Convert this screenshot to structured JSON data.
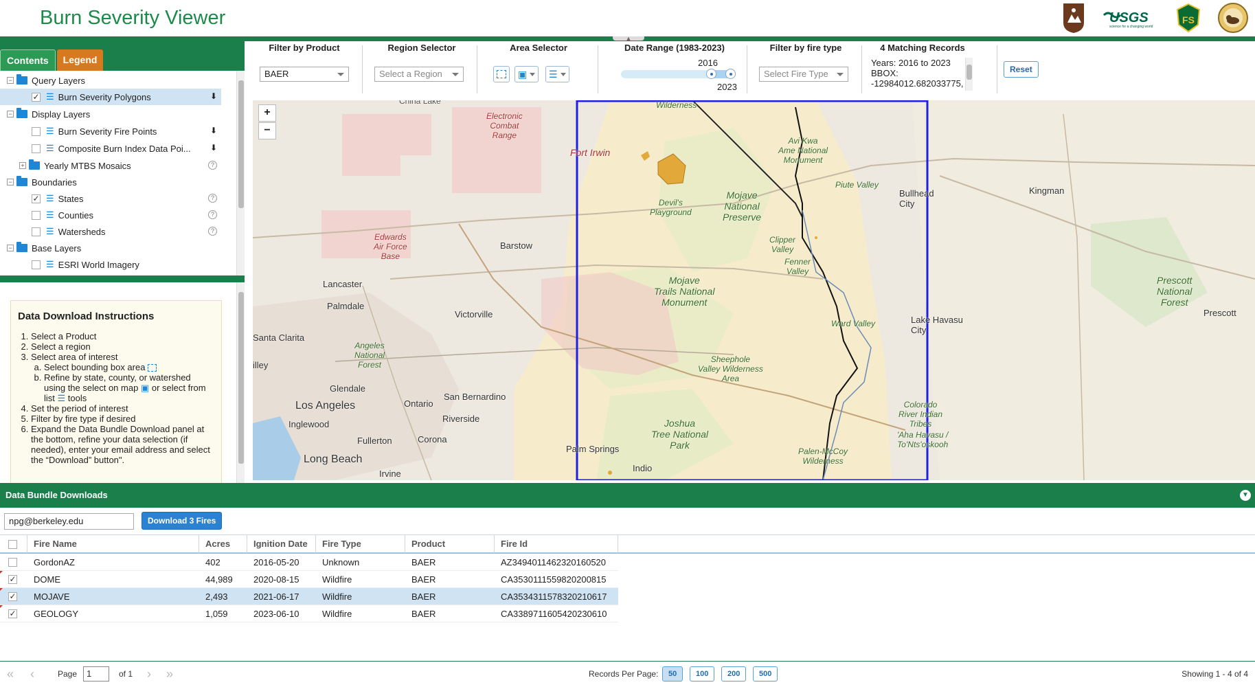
{
  "app": {
    "title": "Burn Severity Viewer"
  },
  "left_panel": {
    "tabs": [
      {
        "label": "Contents"
      },
      {
        "label": "Legend"
      }
    ],
    "toc": {
      "query_layers": "Query Layers",
      "burn_severity_polygons": "Burn Severity Polygons",
      "display_layers": "Display Layers",
      "burn_severity_fire_points": "Burn Severity Fire Points",
      "composite_burn_index": "Composite Burn Index Data Poi...",
      "yearly_mtbs_mosaics": "Yearly MTBS Mosaics",
      "boundaries": "Boundaries",
      "states": "States",
      "counties": "Counties",
      "watersheds": "Watersheds",
      "base_layers": "Base Layers",
      "esri_world_imagery": "ESRI World Imagery"
    },
    "instructions": {
      "title": "Data Download Instructions",
      "step1": "Select a Product",
      "step2": "Select a region",
      "step3": "Select area of interest",
      "step3a": "Select bounding box area",
      "step3b_1": "Refine by state, county, or watershed using the select on map",
      "step3b_2": "or select from list",
      "step3b_3": "tools",
      "step4": "Set the period of interest",
      "step5": "Filter by fire type if desired",
      "step6": "Expand the Data Bundle Download panel at the bottom, refine your data selection (if needed), enter your email address and select the “Download” button\"."
    }
  },
  "filters": {
    "product": {
      "title": "Filter by Product",
      "value": "BAER"
    },
    "region": {
      "title": "Region Selector",
      "placeholder": "Select a Region"
    },
    "area": {
      "title": "Area Selector"
    },
    "date_range": {
      "title": "Date Range (1983-2023)",
      "start": "2016",
      "end": "2023",
      "range_start_fraction": 0.825,
      "range_end_fraction": 1.0
    },
    "fire_type": {
      "title": "Filter by fire type",
      "placeholder": "Select Fire Type"
    },
    "records": {
      "title": "4 Matching Records",
      "line1": "Years: 2016 to 2023",
      "line2": "BBOX:",
      "line3": "-12984012.682033775,"
    },
    "reset_label": "Reset"
  },
  "map": {
    "zoom_in": "+",
    "zoom_out": "−",
    "labels": {
      "china_lake": "China Lake",
      "electronic_combat": "Electronic\nCombat\nRange",
      "fort_irwin": "Fort Irwin",
      "wilderness_top": "Wilderness",
      "avi_kwa_ame": "Avi Kwa\nAme National\nMonument",
      "piute_valley": "Piute Valley",
      "bullhead_city": "Bullhead\nCity",
      "kingman": "Kingman",
      "devils_playground": "Devil's\nPlayground",
      "mojave_preserve": "Mojave\nNational\nPreserve",
      "clipper_valley": "Clipper\nValley",
      "fenner_valley": "Fenner\nValley",
      "barstow": "Barstow",
      "edwards": "Edwards\nAir Force\nBase",
      "lancaster": "Lancaster",
      "palmdale": "Palmdale",
      "mojave_trails": "Mojave\nTrails National\nMonument",
      "victorville": "Victorville",
      "lake_havasu": "Lake Havasu\nCity",
      "prescott_forest": "Prescott\nNational\nForest",
      "prescott": "Prescott",
      "santa_clarita": "Santa Clarita",
      "angeles": "Angeles\nNational\nForest",
      "ward_valley": "Ward Valley",
      "sheephole": "Sheephole\nValley Wilderness\nArea",
      "glendale": "Glendale",
      "san_bernardino": "San Bernardino",
      "los_angeles": "Los Angeles",
      "ontario": "Ontario",
      "inglewood": "Inglewood",
      "riverside": "Riverside",
      "fullerton": "Fullerton",
      "corona": "Corona",
      "long_beach": "Long Beach",
      "irvine": "Irvine",
      "joshua_tree": "Joshua\nTree National\nPark",
      "palm_springs": "Palm Springs",
      "indio": "Indio",
      "colorado_river": "Colorado\nRiver Indian\nTribes",
      "avi_havasu": "'Aha Havasu /\nTo'Nts'oskooh",
      "palen_mccoy": "Palen-McCoy\nWilderness",
      "illey": "illey"
    }
  },
  "bundle": {
    "title": "Data Bundle Downloads",
    "email_value": "npg@berkeley.edu",
    "download_label": "Download 3 Fires",
    "columns": [
      "Fire Name",
      "Acres",
      "Ignition Date",
      "Fire Type",
      "Product",
      "Fire Id"
    ],
    "rows": [
      {
        "checked": false,
        "selected": false,
        "name": "GordonAZ",
        "acres": "402",
        "date": "2016-05-20",
        "type": "Unknown",
        "product": "BAER",
        "id": "AZ3494011462320160520"
      },
      {
        "checked": true,
        "selected": false,
        "name": "DOME",
        "acres": "44,989",
        "date": "2020-08-15",
        "type": "Wildfire",
        "product": "BAER",
        "id": "CA3530111559820200815"
      },
      {
        "checked": true,
        "selected": true,
        "name": "MOJAVE",
        "acres": "2,493",
        "date": "2021-06-17",
        "type": "Wildfire",
        "product": "BAER",
        "id": "CA3534311578320210617"
      },
      {
        "checked": true,
        "selected": false,
        "name": "GEOLOGY",
        "acres": "1,059",
        "date": "2023-06-10",
        "type": "Wildfire",
        "product": "BAER",
        "id": "CA3389711605420230610"
      }
    ]
  },
  "pager": {
    "page_label": "Page",
    "page_value": "1",
    "of_label": "of 1",
    "rpp_label": "Records Per Page:",
    "rpp_options": [
      "50",
      "100",
      "200",
      "500"
    ],
    "rpp_selected": "50",
    "showing": "Showing 1 - 4 of 4"
  },
  "colors": {
    "brand_green": "#1a7f4a",
    "legend_tab": "#d77a1f",
    "selection_box": "#1f1fe0",
    "selected_row": "#cfe3f3"
  }
}
